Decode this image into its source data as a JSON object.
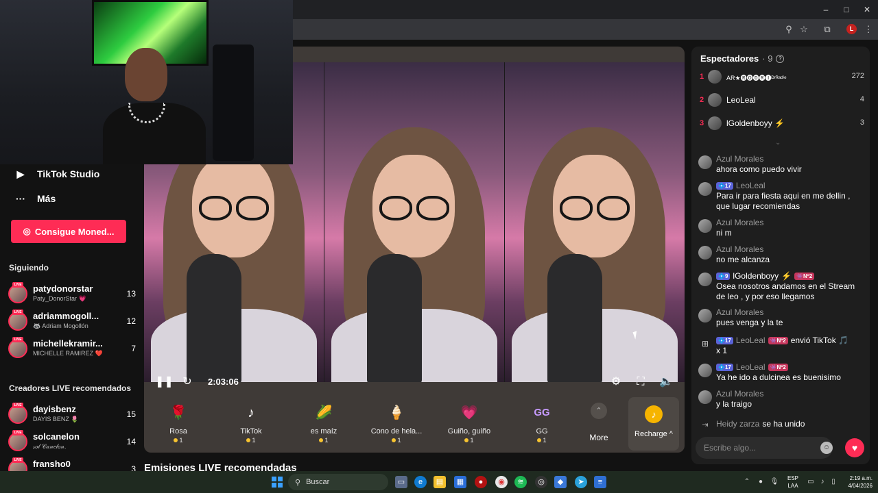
{
  "window": {
    "minimize": "–",
    "maximize": "□",
    "close": "✕"
  },
  "browser_bar": {
    "profile_letter": "L"
  },
  "sidebar": {
    "links": [
      {
        "label": "TikTok Studio",
        "icon": "studio-icon"
      },
      {
        "label": "Más",
        "icon": "more-dots-icon"
      }
    ],
    "coins_button": "Consigue Moned...",
    "following_heading": "Siguiendo",
    "following": [
      {
        "name": "patydonorstar",
        "sub": "Paty_DonorStar 💗",
        "count": "13"
      },
      {
        "name": "adriammogoll...",
        "sub": "🦝 Adriam Mogollón",
        "count": "12"
      },
      {
        "name": "michellekramir...",
        "sub": "MICHELLE RAMIREZ ❤️",
        "count": "7"
      }
    ],
    "recommended_heading": "Creadores LIVE recomendados",
    "recommended": [
      {
        "name": "dayisbenz",
        "sub": "DAYIS BENZ 🌷",
        "count": "15"
      },
      {
        "name": "solcanelon",
        "sub": "𝓈𝑜𝓁 𝒞𝒶𝓃𝑒𝓁𝑜𝓃.",
        "count": "14"
      },
      {
        "name": "fransho0",
        "sub": "",
        "count": "3"
      }
    ]
  },
  "player": {
    "time": "2:03:06",
    "live_badge": "LIVE"
  },
  "gifts": [
    {
      "name": "Rosa",
      "price": "1",
      "icon": "🌹",
      "color": "#e0344f"
    },
    {
      "name": "TikTok",
      "price": "1",
      "icon": "♪",
      "color": "#c3b7ff"
    },
    {
      "name": "es maíz",
      "price": "1",
      "icon": "🌽",
      "color": "#f6c330"
    },
    {
      "name": "Cono de hela...",
      "price": "1",
      "icon": "🍦",
      "color": "#f7c7d7"
    },
    {
      "name": "Guiño, guiño",
      "price": "1",
      "icon": "💗",
      "color": "#ff6fae"
    },
    {
      "name": "GG",
      "price": "1",
      "icon": "GG",
      "color": "#c79bff"
    }
  ],
  "more_label": "More",
  "recharge_label": "Recharge ^",
  "recommended_streams_title": "Emisiones LIVE recomendadas",
  "viewers": {
    "title": "Espectadores",
    "count": "· 9",
    "ranks": [
      {
        "rank": "1",
        "name": "AR★🅡🅞🅓🅡🅘ᴰʳᴿᵃᵈⁱᵉ",
        "score": "272"
      },
      {
        "rank": "2",
        "name": "LeoLeal",
        "score": "4"
      },
      {
        "rank": "3",
        "name": "lGoldenboyy ⚡",
        "score": "3"
      }
    ]
  },
  "chat": [
    {
      "user": "Azul Morales",
      "badges": [],
      "text": "ahora como puedo vivir"
    },
    {
      "user": "LeoLeal",
      "badges": [
        "💠17"
      ],
      "text": "Para ir para fiesta aqui en me dellin , que lugar recomiendas"
    },
    {
      "user": "Azul Morales",
      "badges": [],
      "text": "ni m"
    },
    {
      "user": "Azul Morales",
      "badges": [],
      "text": "no me alcanza"
    },
    {
      "user": "lGoldenboyy",
      "badges": [
        "💠9",
        "⚡",
        "👾Nº2"
      ],
      "text": "Osea nosotros andamos en el Stream de leo , y por eso llegamos"
    },
    {
      "user": "Azul Morales",
      "badges": [],
      "text": "pues venga y la te"
    },
    {
      "user": "LeoLeal",
      "badges": [
        "💠17",
        "👾Nº2"
      ],
      "text": "x 1",
      "gift_text": "envió TikTok 🎵"
    },
    {
      "user": "LeoLeal",
      "badges": [
        "💠17",
        "👾Nº2"
      ],
      "text": "Ya he ido a dulcinea es buenisimo"
    },
    {
      "user": "Azul Morales",
      "badges": [],
      "text": "y la traigo"
    }
  ],
  "joined": {
    "user": "Heidy zarza",
    "text": "se ha unido"
  },
  "chat_input_placeholder": "Escribe algo...",
  "taskbar": {
    "search": "Buscar",
    "lang": [
      "ESP",
      "LAA"
    ],
    "time": "2:19 a.m.",
    "date": "4/04/2026"
  }
}
